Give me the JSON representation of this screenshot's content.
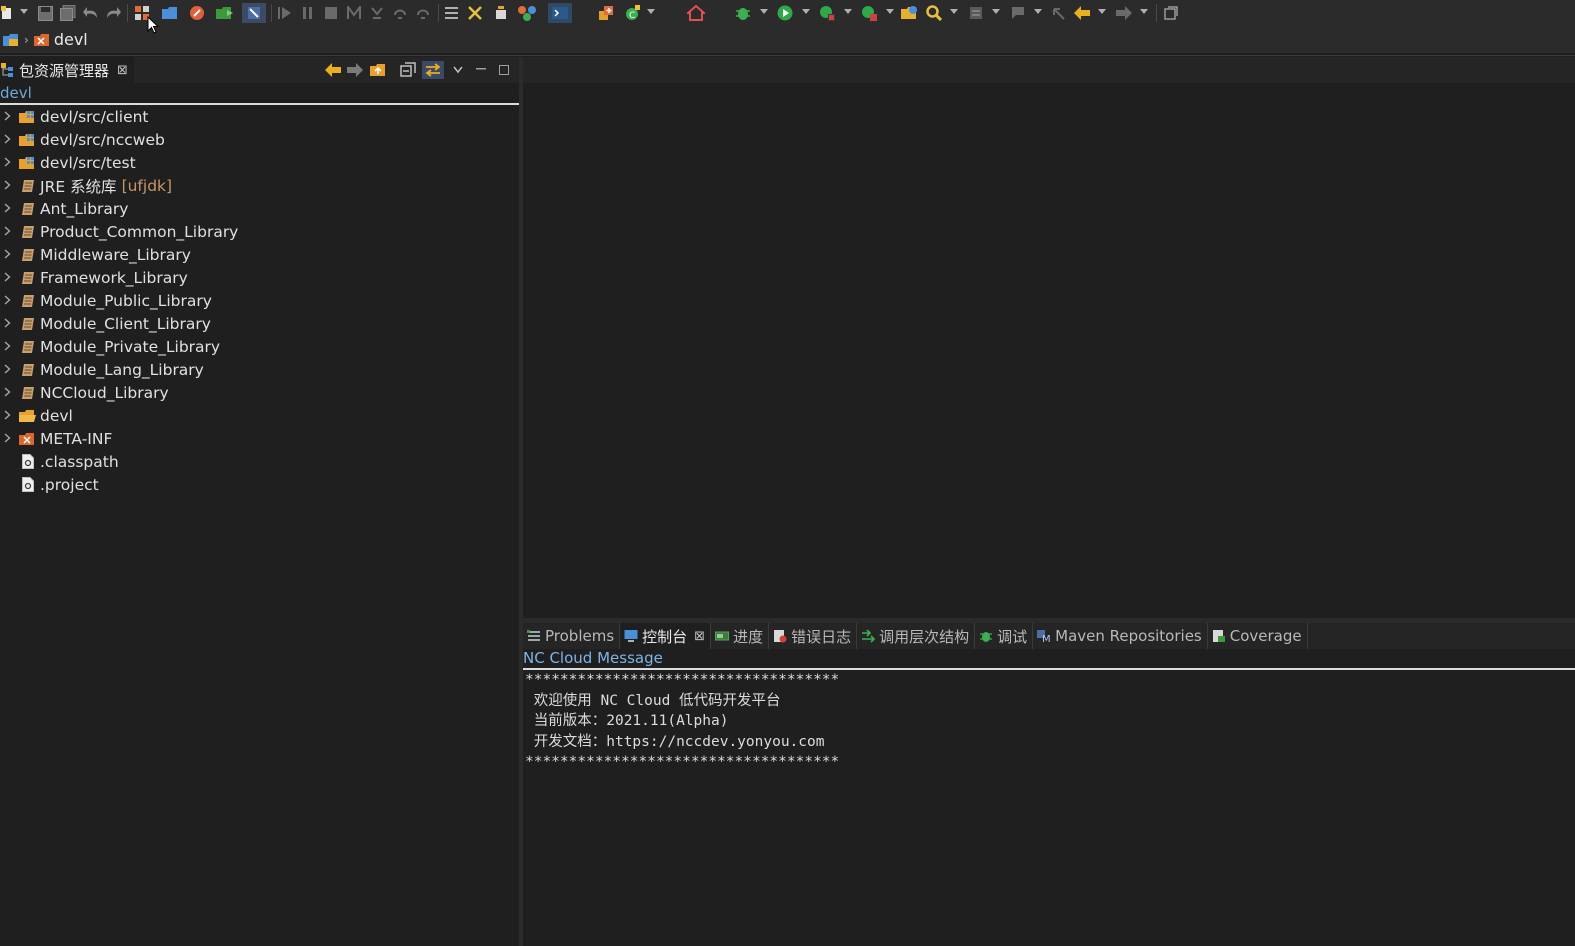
{
  "breadcrumb": {
    "project": "devl"
  },
  "package_explorer": {
    "tab_label": "包资源管理器",
    "tab_close": "⊠",
    "filter_text": "devl",
    "items": [
      {
        "label": "devl/src/client",
        "icon": "source-folder-icon",
        "expandable": true,
        "decoration": ""
      },
      {
        "label": "devl/src/nccweb",
        "icon": "source-folder-icon",
        "expandable": true,
        "decoration": ""
      },
      {
        "label": "devl/src/test",
        "icon": "source-folder-icon",
        "expandable": true,
        "decoration": ""
      },
      {
        "label": "JRE 系统库",
        "icon": "library-icon",
        "expandable": true,
        "decoration": "[ufjdk]"
      },
      {
        "label": "Ant_Library",
        "icon": "library-icon",
        "expandable": true,
        "decoration": ""
      },
      {
        "label": "Product_Common_Library",
        "icon": "library-icon",
        "expandable": true,
        "decoration": ""
      },
      {
        "label": "Middleware_Library",
        "icon": "library-icon",
        "expandable": true,
        "decoration": ""
      },
      {
        "label": "Framework_Library",
        "icon": "library-icon",
        "expandable": true,
        "decoration": ""
      },
      {
        "label": "Module_Public_Library",
        "icon": "library-icon",
        "expandable": true,
        "decoration": ""
      },
      {
        "label": "Module_Client_Library",
        "icon": "library-icon",
        "expandable": true,
        "decoration": ""
      },
      {
        "label": "Module_Private_Library",
        "icon": "library-icon",
        "expandable": true,
        "decoration": ""
      },
      {
        "label": "Module_Lang_Library",
        "icon": "library-icon",
        "expandable": true,
        "decoration": ""
      },
      {
        "label": "NCCloud_Library",
        "icon": "library-icon",
        "expandable": true,
        "decoration": ""
      },
      {
        "label": "devl",
        "icon": "folder-icon",
        "expandable": true,
        "decoration": ""
      },
      {
        "label": "META-INF",
        "icon": "meta-folder-icon",
        "expandable": true,
        "decoration": ""
      },
      {
        "label": ".classpath",
        "icon": "file-icon",
        "expandable": false,
        "decoration": ""
      },
      {
        "label": ".project",
        "icon": "file-icon",
        "expandable": false,
        "decoration": ""
      }
    ]
  },
  "bottom_tabs": [
    {
      "label": "Problems",
      "icon": "problems-icon",
      "active": false
    },
    {
      "label": "控制台",
      "icon": "console-icon",
      "active": true
    },
    {
      "label": "进度",
      "icon": "progress-icon",
      "active": false
    },
    {
      "label": "错误日志",
      "icon": "error-log-icon",
      "active": false
    },
    {
      "label": "调用层次结构",
      "icon": "call-hierarchy-icon",
      "active": false
    },
    {
      "label": "调试",
      "icon": "debug-icon",
      "active": false
    },
    {
      "label": "Maven Repositories",
      "icon": "maven-icon",
      "active": false
    },
    {
      "label": "Coverage",
      "icon": "coverage-icon",
      "active": false
    }
  ],
  "console": {
    "title": "NC Cloud Message",
    "lines": [
      "************************************",
      " 欢迎使用 NC Cloud 低代码开发平台",
      " 当前版本：2021.11(Alpha)",
      " 开发文档：https://nccdev.yonyou.com",
      "************************************"
    ]
  },
  "colors": {
    "background": "#1f1f1f",
    "toolbar": "#2b2b2b",
    "link_blue": "#7fb3e8",
    "decoration_orange": "#c89664"
  }
}
